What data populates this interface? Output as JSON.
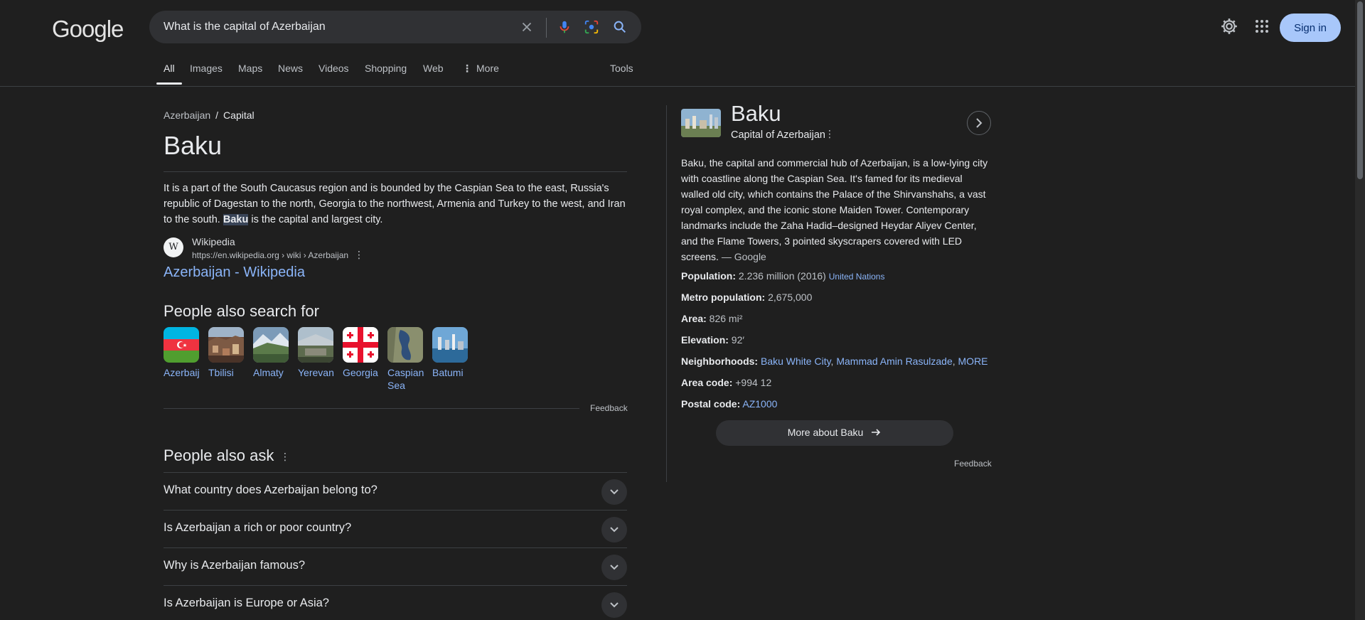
{
  "header": {
    "logo": "Google",
    "search_query": "What is the capital of Azerbaijan",
    "signin_label": "Sign in"
  },
  "tabs": [
    {
      "label": "All"
    },
    {
      "label": "Images"
    },
    {
      "label": "Maps"
    },
    {
      "label": "News"
    },
    {
      "label": "Videos"
    },
    {
      "label": "Shopping"
    },
    {
      "label": "Web"
    },
    {
      "label": "More"
    },
    {
      "label": "Tools"
    }
  ],
  "answer": {
    "breadcrumb_parent": "Azerbaijan",
    "breadcrumb_sep": "/",
    "breadcrumb_current": "Capital",
    "title": "Baku",
    "snippet_before": "It is a part of the South Caucasus region and is bounded by the Caspian Sea to the east, Russia's republic of Dagestan to the north, Georgia to the northwest, Armenia and Turkey to the west, and Iran to the south. ",
    "snippet_highlight": "Baku",
    "snippet_after": " is the capital and largest city.",
    "source_name": "Wikipedia",
    "source_url": "https://en.wikipedia.org › wiki › Azerbaijan",
    "result_title": "Azerbaijan - Wikipedia"
  },
  "people_also_search": {
    "heading": "People also search for",
    "items": [
      {
        "label": "Azerbaij"
      },
      {
        "label": "Tbilisi"
      },
      {
        "label": "Almaty"
      },
      {
        "label": "Yerevan"
      },
      {
        "label": "Georgia"
      },
      {
        "label": "Caspian Sea"
      },
      {
        "label": "Batumi"
      }
    ],
    "feedback": "Feedback"
  },
  "people_also_ask": {
    "heading": "People also ask",
    "questions": [
      "What country does Azerbaijan belong to?",
      "Is Azerbaijan a rich or poor country?",
      "Why is Azerbaijan famous?",
      "Is Azerbaijan is Europe or Asia?"
    ]
  },
  "knowledge_panel": {
    "title": "Baku",
    "subtitle": "Capital of Azerbaijan",
    "description": "Baku, the capital and commercial hub of Azerbaijan, is a low-lying city with coastline along the Caspian Sea. It's famed for its medieval walled old city, which contains the Palace of the Shirvanshahs, a vast royal complex, and the iconic stone Maiden Tower. Contemporary landmarks include the Zaha Hadid–designed Heydar Aliyev Center, and the Flame Towers, 3 pointed skyscrapers covered with LED screens.",
    "description_source": "— Google",
    "facts": {
      "population_label": "Population:",
      "population_value": " 2.236 million (2016) ",
      "population_source": "United Nations",
      "metro_label": "Metro population:",
      "metro_value": " 2,675,000",
      "area_label": "Area:",
      "area_value": " 826 mi²",
      "elevation_label": "Elevation:",
      "elevation_value": " 92′",
      "neigh_label": "Neighborhoods:",
      "neigh_1": "Baku White City",
      "neigh_2": "Mammad Amin Rasulzade",
      "neigh_more": "MORE",
      "areacode_label": "Area code:",
      "areacode_value": " +994 12",
      "postal_label": "Postal code:",
      "postal_value": "AZ1000"
    },
    "more_button": "More about Baku",
    "feedback": "Feedback"
  },
  "colors": {
    "background": "#1f1f1f",
    "link": "#8ab4f8",
    "signin_bg": "#a8c7fa"
  }
}
